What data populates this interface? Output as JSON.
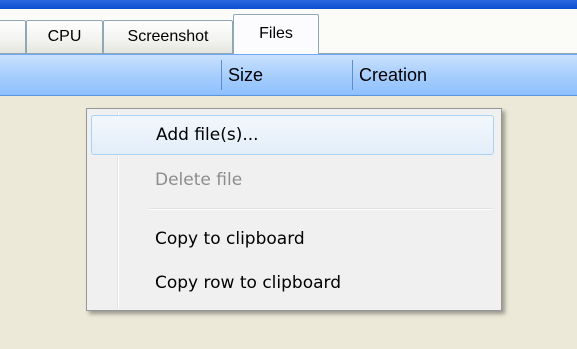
{
  "tabs": {
    "cpu_label": "CPU",
    "screenshot_label": "Screenshot",
    "files_label": "Files"
  },
  "table_header": {
    "columns": [
      "Size",
      "Creation"
    ]
  },
  "context_menu": {
    "items": [
      {
        "label": "Add file(s)...",
        "state": "hovered"
      },
      {
        "label": "Delete file",
        "state": "disabled"
      },
      {
        "label": "Copy to clipboard",
        "state": "enabled"
      },
      {
        "label": "Copy row to clipboard",
        "state": "enabled"
      }
    ]
  },
  "colors": {
    "title_blue": "#0b4fcf",
    "header_blue": "#a5cdfd",
    "menu_background": "#f0f0f0",
    "hover_border": "#a8d2f4",
    "disabled_text": "#8d8d8d",
    "window_background": "#ece9d8"
  }
}
